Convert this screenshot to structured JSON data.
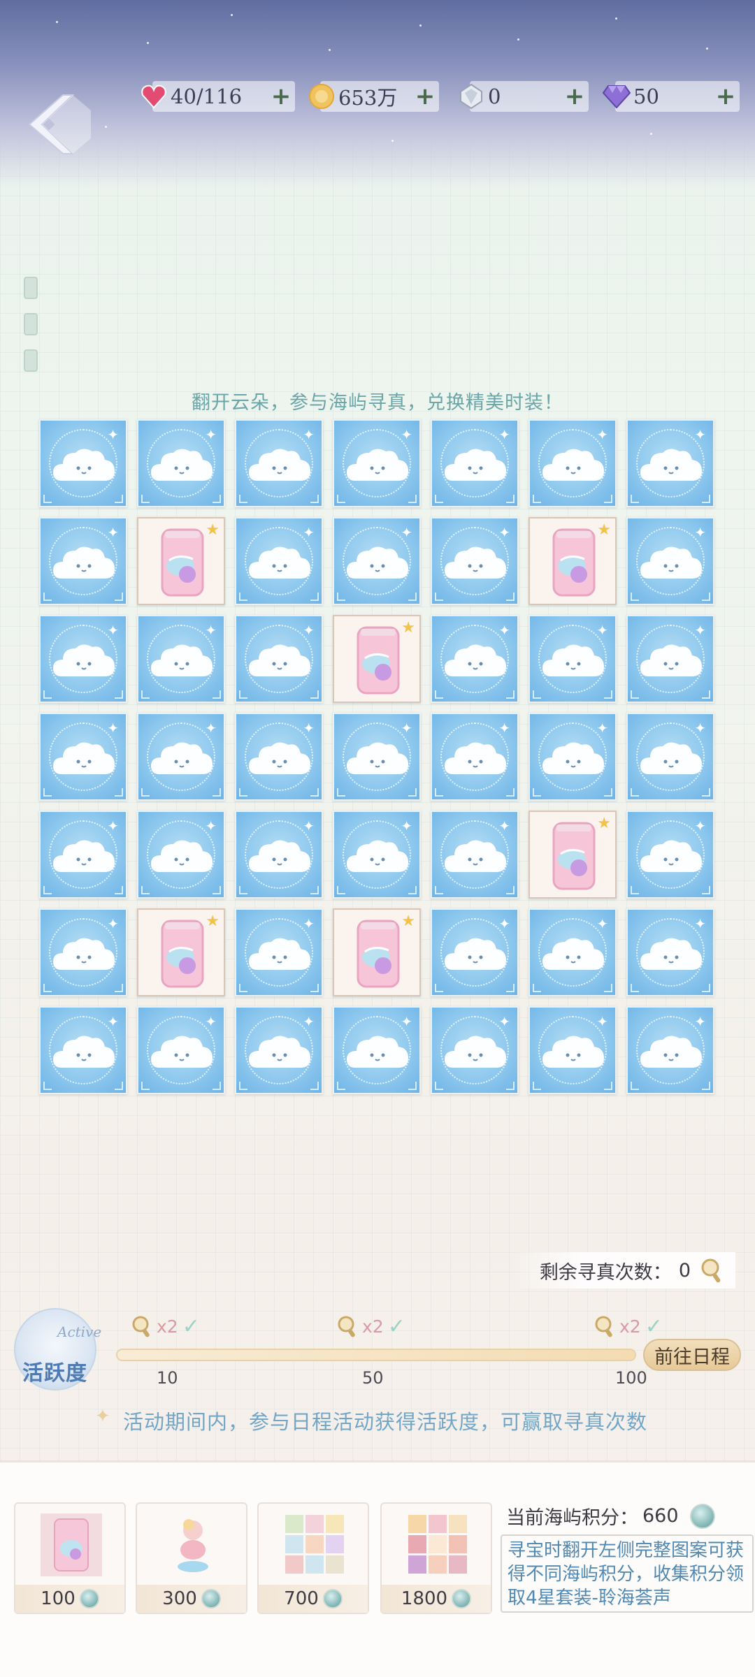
{
  "currency": [
    {
      "icon": "heart-gem-icon",
      "value": "40/116",
      "plus": "+"
    },
    {
      "icon": "gold-coin-icon",
      "value": "653万",
      "plus": "+"
    },
    {
      "icon": "crystal-icon",
      "value": "0",
      "plus": "+"
    },
    {
      "icon": "diamond-icon",
      "value": "50",
      "plus": "+"
    }
  ],
  "instruction": "翻开云朵，参与海屿寻真，兑换精美时装！",
  "grid": [
    [
      "cloud",
      "cloud",
      "cloud",
      "cloud",
      "cloud",
      "cloud",
      "cloud"
    ],
    [
      "cloud",
      "can",
      "cloud",
      "cloud",
      "cloud",
      "can",
      "cloud"
    ],
    [
      "cloud",
      "cloud",
      "cloud",
      "can",
      "cloud",
      "cloud",
      "cloud"
    ],
    [
      "cloud",
      "cloud",
      "cloud",
      "cloud",
      "cloud",
      "cloud",
      "cloud"
    ],
    [
      "cloud",
      "cloud",
      "cloud",
      "cloud",
      "cloud",
      "can",
      "cloud"
    ],
    [
      "cloud",
      "can",
      "cloud",
      "can",
      "cloud",
      "cloud",
      "cloud"
    ],
    [
      "cloud",
      "cloud",
      "cloud",
      "cloud",
      "cloud",
      "cloud",
      "cloud"
    ]
  ],
  "remaining": {
    "label": "剩余寻真次数：",
    "value": "0"
  },
  "activity": {
    "badge_en": "Active",
    "badge_cn": "活跃度",
    "milestones": [
      {
        "mult": "x2",
        "check": "✓",
        "value": "10"
      },
      {
        "mult": "x2",
        "check": "✓",
        "value": "50"
      },
      {
        "mult": "x2",
        "check": "✓",
        "value": "100"
      }
    ],
    "progress_fraction": 1.0,
    "goto_label": "前往日程",
    "note": "活动期间内，参与日程活动获得活跃度，可赢取寻真次数"
  },
  "rewards": [
    {
      "name": "can",
      "cost": "100"
    },
    {
      "name": "doll",
      "cost": "300"
    },
    {
      "name": "outfit-set",
      "cost": "700"
    },
    {
      "name": "dessert-set",
      "cost": "1800"
    }
  ],
  "score": {
    "label": "当前海屿积分：",
    "value": "660"
  },
  "description": "寻宝时翻开左侧完整图案可获得不同海屿积分，收集积分领取4星套装-聆海荟声",
  "colors": {
    "accent": "#6aa6a7",
    "tile_blue": "#8ec8ee",
    "note_blue": "#73a6c6"
  }
}
